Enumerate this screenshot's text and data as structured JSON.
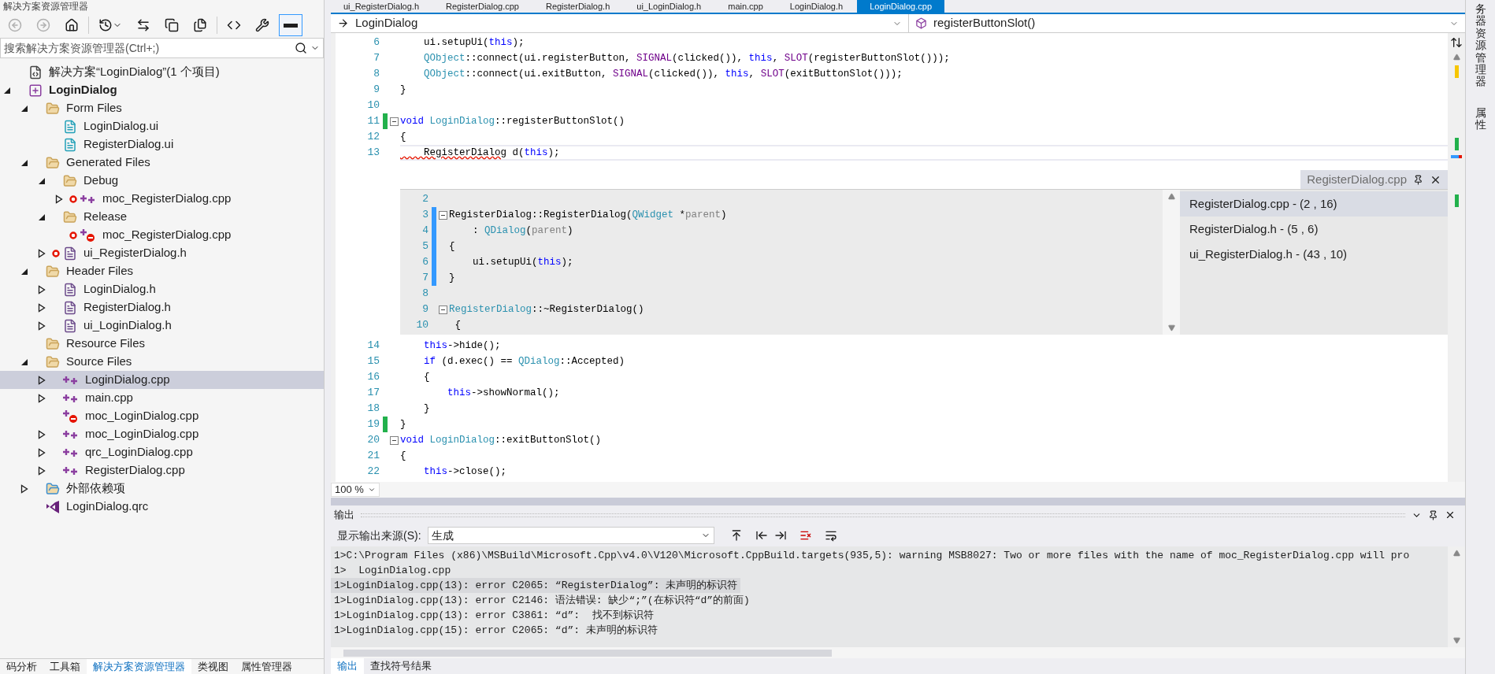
{
  "explorer": {
    "title": "解决方案资源管理器",
    "toolbar": [
      {
        "kind": "back",
        "selected": false
      },
      {
        "kind": "forward",
        "selected": false
      },
      {
        "kind": "home",
        "selected": false
      },
      {
        "kind": "history",
        "selected": false
      },
      {
        "kind": "sync",
        "selected": false
      },
      {
        "kind": "collapse",
        "selected": false
      },
      {
        "kind": "files",
        "selected": false
      },
      {
        "kind": "code",
        "selected": false
      },
      {
        "kind": "properties",
        "selected": false
      },
      {
        "kind": "preview",
        "selected": true
      }
    ],
    "search": {
      "placeholder": "搜索解决方案资源管理器(Ctrl+;)"
    },
    "tree": [
      {
        "label": "解决方案“LoginDialog”(1 个项目)",
        "kind": "solution",
        "selected": false,
        "marked": false
      },
      {
        "label": "LoginDialog",
        "kind": "project",
        "bold": true,
        "expanded": true,
        "selected": false,
        "marked": false,
        "children": [
          {
            "label": "Form Files",
            "kind": "folder",
            "expanded": true,
            "selected": false,
            "marked": false,
            "children": [
              {
                "label": "LoginDialog.ui",
                "kind": "ui",
                "selected": false,
                "marked": false
              },
              {
                "label": "RegisterDialog.ui",
                "kind": "ui",
                "selected": false,
                "marked": false
              }
            ]
          },
          {
            "label": "Generated Files",
            "kind": "folder",
            "expanded": true,
            "selected": false,
            "marked": false,
            "children": [
              {
                "label": "Debug",
                "kind": "folder",
                "expanded": true,
                "selected": false,
                "marked": false,
                "children": [
                  {
                    "label": "moc_RegisterDialog.cpp",
                    "kind": "cpp",
                    "expanded": false,
                    "selected": false,
                    "marked": true
                  }
                ]
              },
              {
                "label": "Release",
                "kind": "folder",
                "expanded": true,
                "selected": false,
                "marked": false,
                "children": [
                  {
                    "label": "moc_RegisterDialog.cpp",
                    "kind": "excluded",
                    "selected": false,
                    "marked": true
                  }
                ]
              },
              {
                "label": "ui_RegisterDialog.h",
                "kind": "header",
                "expanded": false,
                "selected": false,
                "marked": true
              }
            ]
          },
          {
            "label": "Header Files",
            "kind": "folder",
            "expanded": true,
            "selected": false,
            "marked": false,
            "children": [
              {
                "label": "LoginDialog.h",
                "kind": "header",
                "expanded": false,
                "selected": false,
                "marked": false
              },
              {
                "label": "RegisterDialog.h",
                "kind": "header",
                "expanded": false,
                "selected": false,
                "marked": false
              },
              {
                "label": "ui_LoginDialog.h",
                "kind": "header",
                "expanded": false,
                "selected": false,
                "marked": false
              }
            ]
          },
          {
            "label": "Resource Files",
            "kind": "folder",
            "selected": false,
            "marked": false
          },
          {
            "label": "Source Files",
            "kind": "folder",
            "expanded": true,
            "selected": false,
            "marked": false,
            "children": [
              {
                "label": "LoginDialog.cpp",
                "kind": "cpp",
                "expanded": false,
                "selected": true,
                "marked": false
              },
              {
                "label": "main.cpp",
                "kind": "cpp",
                "expanded": false,
                "selected": false,
                "marked": false
              },
              {
                "label": "moc_LoginDialog.cpp",
                "kind": "excluded",
                "selected": false,
                "marked": false
              },
              {
                "label": "moc_LoginDialog.cpp",
                "kind": "cpp",
                "expanded": false,
                "selected": false,
                "marked": false
              },
              {
                "label": "qrc_LoginDialog.cpp",
                "kind": "cpp",
                "expanded": false,
                "selected": false,
                "marked": false
              },
              {
                "label": "RegisterDialog.cpp",
                "kind": "cpp",
                "expanded": false,
                "selected": false,
                "marked": false
              }
            ]
          },
          {
            "label": "外部依赖项",
            "kind": "deps",
            "expanded": false,
            "selected": false,
            "marked": false
          },
          {
            "label": "LoginDialog.qrc",
            "kind": "qrc",
            "selected": false,
            "marked": false
          }
        ]
      }
    ],
    "bottom_tabs": [
      {
        "label": "码分析",
        "selected": false
      },
      {
        "label": "工具箱",
        "selected": false
      },
      {
        "label": "解决方案资源管理器",
        "selected": true
      },
      {
        "label": "类视图",
        "selected": false
      },
      {
        "label": "属性管理器",
        "selected": false
      }
    ]
  },
  "doc_tabs": [
    {
      "label": "ui_RegisterDialog.h",
      "selected": false
    },
    {
      "label": "RegisterDialog.cpp",
      "selected": false
    },
    {
      "label": "RegisterDialog.h",
      "selected": false
    },
    {
      "label": "ui_LoginDialog.h",
      "selected": false
    },
    {
      "label": "main.cpp",
      "selected": false
    },
    {
      "label": "LoginDialog.h",
      "selected": false
    },
    {
      "label": "LoginDialog.cpp",
      "selected": true
    }
  ],
  "nav": {
    "scope": "LoginDialog",
    "member": "registerButtonSlot()"
  },
  "code_before": [
    {
      "number": "6",
      "tokens": [
        {
          "kind": "plain",
          "text": "    ui.setupUi("
        },
        {
          "kind": "kw",
          "text": "this"
        },
        {
          "kind": "plain",
          "text": ");"
        }
      ]
    },
    {
      "number": "7",
      "tokens": [
        {
          "kind": "type",
          "text": "    QObject"
        },
        {
          "kind": "plain",
          "text": "::connect(ui.registerButton, "
        },
        {
          "kind": "macro",
          "text": "SIGNAL"
        },
        {
          "kind": "plain",
          "text": "(clicked()), "
        },
        {
          "kind": "kw",
          "text": "this"
        },
        {
          "kind": "plain",
          "text": ", "
        },
        {
          "kind": "macro",
          "text": "SLOT"
        },
        {
          "kind": "plain",
          "text": "(registerButtonSlot()));"
        }
      ]
    },
    {
      "number": "8",
      "tokens": [
        {
          "kind": "type",
          "text": "    QObject"
        },
        {
          "kind": "plain",
          "text": "::connect(ui.exitButton, "
        },
        {
          "kind": "macro",
          "text": "SIGNAL"
        },
        {
          "kind": "plain",
          "text": "(clicked()), "
        },
        {
          "kind": "kw",
          "text": "this"
        },
        {
          "kind": "plain",
          "text": ", "
        },
        {
          "kind": "macro",
          "text": "SLOT"
        },
        {
          "kind": "plain",
          "text": "(exitButtonSlot()));"
        }
      ]
    },
    {
      "number": "9",
      "tokens": [
        {
          "kind": "plain",
          "text": "}"
        }
      ]
    },
    {
      "number": "10"
    },
    {
      "number": "11",
      "fold": true,
      "changed": true,
      "tokens": [
        {
          "kind": "kw",
          "text": "void"
        },
        {
          "kind": "type",
          "text": " LoginDialog"
        },
        {
          "kind": "plain",
          "text": "::registerButtonSlot()"
        }
      ]
    },
    {
      "number": "12",
      "tokens": [
        {
          "kind": "plain",
          "text": "{"
        }
      ]
    },
    {
      "number": "13",
      "current": true,
      "tokens": [
        {
          "kind": "error",
          "text": "    RegisterDialog"
        },
        {
          "kind": "plain",
          "text": " d("
        },
        {
          "kind": "kw",
          "text": "this"
        },
        {
          "kind": "plain",
          "text": ");"
        }
      ]
    }
  ],
  "peek": {
    "file": "RegisterDialog.cpp",
    "lines": [
      {
        "number": "2"
      },
      {
        "number": "3",
        "fold": true,
        "changed": true,
        "tokens": [
          {
            "kind": "plain",
            "text": "RegisterDialog::RegisterDialog("
          },
          {
            "kind": "type",
            "text": "QWidget"
          },
          {
            "kind": "plain",
            "text": " *"
          },
          {
            "kind": "param",
            "text": "parent"
          },
          {
            "kind": "plain",
            "text": ")"
          }
        ]
      },
      {
        "number": "4",
        "changed": true,
        "tokens": [
          {
            "kind": "plain",
            "text": "    : "
          },
          {
            "kind": "type",
            "text": "QDialog"
          },
          {
            "kind": "plain",
            "text": "("
          },
          {
            "kind": "param",
            "text": "parent"
          },
          {
            "kind": "plain",
            "text": ")"
          }
        ]
      },
      {
        "number": "5",
        "changed": true,
        "tokens": [
          {
            "kind": "plain",
            "text": "{"
          }
        ]
      },
      {
        "number": "6",
        "changed": true,
        "tokens": [
          {
            "kind": "plain",
            "text": "    ui.setupUi("
          },
          {
            "kind": "kw",
            "text": "this"
          },
          {
            "kind": "plain",
            "text": ");"
          }
        ]
      },
      {
        "number": "7",
        "changed": true,
        "tokens": [
          {
            "kind": "plain",
            "text": "}"
          }
        ]
      },
      {
        "number": "8"
      },
      {
        "number": "9",
        "fold": true,
        "tokens": [
          {
            "kind": "type",
            "text": "RegisterDialog"
          },
          {
            "kind": "plain",
            "text": "::~RegisterDialog()"
          }
        ]
      },
      {
        "number": "10",
        "tokens": [
          {
            "kind": "plain",
            "text": " {"
          }
        ]
      }
    ],
    "results": [
      {
        "label": "RegisterDialog.cpp - (2 , 16)",
        "selected": true
      },
      {
        "label": "RegisterDialog.h - (5 , 6)",
        "selected": false
      },
      {
        "label": "ui_RegisterDialog.h - (43 , 10)",
        "selected": false
      }
    ]
  },
  "code_after": [
    {
      "number": "14",
      "tokens": [
        {
          "kind": "kw",
          "text": "    this"
        },
        {
          "kind": "plain",
          "text": "->hide();"
        }
      ]
    },
    {
      "number": "15",
      "tokens": [
        {
          "kind": "kw",
          "text": "    if"
        },
        {
          "kind": "plain",
          "text": " (d.exec() == "
        },
        {
          "kind": "type",
          "text": "QDialog"
        },
        {
          "kind": "plain",
          "text": "::Accepted)"
        }
      ]
    },
    {
      "number": "16",
      "tokens": [
        {
          "kind": "plain",
          "text": "    {"
        }
      ]
    },
    {
      "number": "17",
      "tokens": [
        {
          "kind": "kw",
          "text": "        this"
        },
        {
          "kind": "plain",
          "text": "->showNormal();"
        }
      ]
    },
    {
      "number": "18",
      "tokens": [
        {
          "kind": "plain",
          "text": "    }"
        }
      ]
    },
    {
      "number": "19",
      "changed": true,
      "tokens": [
        {
          "kind": "plain",
          "text": "}"
        }
      ]
    },
    {
      "number": "20",
      "fold": true,
      "tokens": [
        {
          "kind": "kw",
          "text": "void"
        },
        {
          "kind": "type",
          "text": " LoginDialog"
        },
        {
          "kind": "plain",
          "text": "::exitButtonSlot()"
        }
      ]
    },
    {
      "number": "21",
      "tokens": [
        {
          "kind": "plain",
          "text": "{"
        }
      ]
    },
    {
      "number": "22",
      "tokens": [
        {
          "kind": "kw",
          "text": "    this"
        },
        {
          "kind": "plain",
          "text": "->close();"
        }
      ]
    }
  ],
  "zoom": "100 %",
  "side_tabs": [
    {
      "label": "务器资源管理器",
      "selected": false
    },
    {
      "label": "属性",
      "selected": false
    }
  ],
  "output": {
    "title": "输出",
    "source_label": "显示输出来源(S):",
    "source": "生成",
    "lines": [
      {
        "text": "1>C:\\Program Files (x86)\\MSBuild\\Microsoft.Cpp\\v4.0\\V120\\Microsoft.CppBuild.targets(935,5): warning MSB8027: Two or more files with the name of moc_RegisterDialog.cpp will pro",
        "selected": false
      },
      {
        "text": "1>  LoginDialog.cpp",
        "selected": false
      },
      {
        "text": "1>LoginDialog.cpp(13): error C2065: “RegisterDialog”: 未声明的标识符",
        "selected": true
      },
      {
        "text": "1>LoginDialog.cpp(13): error C2146: 语法错误: 缺少“;”(在标识符“d”的前面)",
        "selected": false
      },
      {
        "text": "1>LoginDialog.cpp(13): error C3861: “d”:  找不到标识符",
        "selected": false
      },
      {
        "text": "1>LoginDialog.cpp(15): error C2065: “d”: 未声明的标识符",
        "selected": false
      }
    ],
    "tabs": [
      {
        "label": "输出",
        "selected": true
      },
      {
        "label": "查找符号结果",
        "selected": false
      }
    ]
  }
}
